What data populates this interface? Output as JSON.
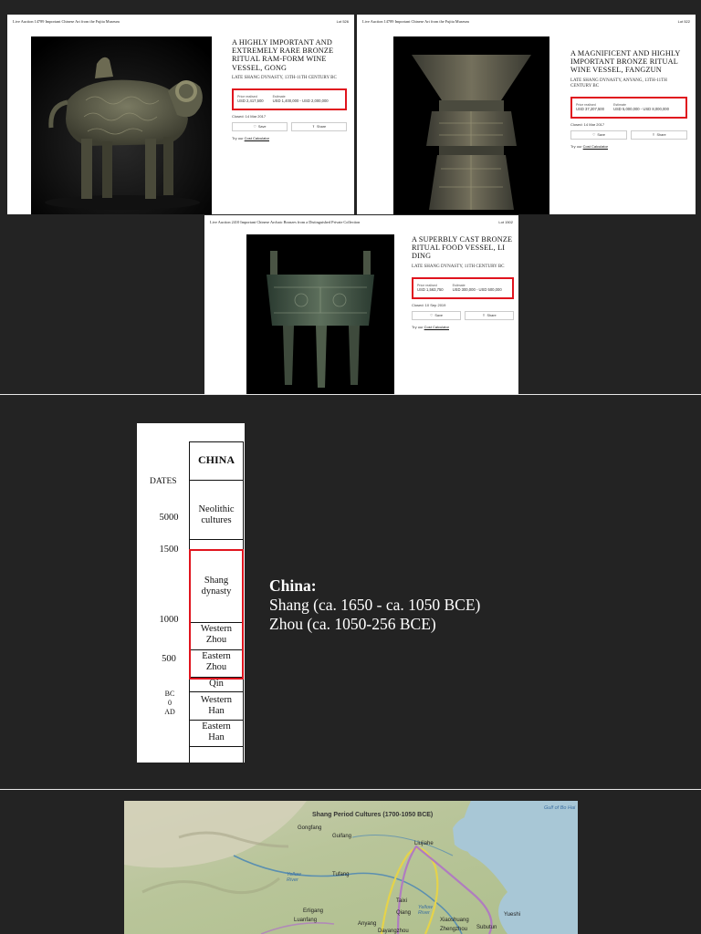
{
  "lots": [
    {
      "id": "lot-ram",
      "header_title": "Live Auction 14789 Important Chinese Art from the Fujita Museum",
      "lot_number": "Lot 526",
      "name": "A HIGHLY IMPORTANT AND EXTREMELY RARE BRONZE RITUAL RAM-FORM WINE VESSEL, GONG",
      "period": "LATE SHANG DYNASTY, 13TH-11TH CENTURY BC",
      "price_label": "Price realised",
      "price": "USD 2,417,500",
      "estimate_label": "Estimate",
      "estimate": "USD 1,400,000 - USD 2,000,000",
      "closed": "Closed: 14 Mar 2017",
      "save": "Save",
      "share": "Share",
      "cost_prefix": "Try our",
      "cost_link": "Cost Calculator"
    },
    {
      "id": "lot-fangzun",
      "header_title": "Live Auction 14789 Important Chinese Art from the Fujita Museum",
      "lot_number": "Lot 522",
      "name": "A MAGNIFICENT AND HIGHLY IMPORTANT BRONZE RITUAL WINE VESSEL, FANGZUN",
      "period": "LATE SHANG DYNASTY, ANYANG, 13TH-11TH CENTURY BC",
      "price_label": "Price realised",
      "price": "USD 37,207,500",
      "estimate_label": "Estimate",
      "estimate": "USD 5,000,000 - USD 8,000,000",
      "closed": "Closed: 14 Mar 2017",
      "save": "Save",
      "share": "Share",
      "cost_prefix": "Try our",
      "cost_link": "Cost Calculator"
    },
    {
      "id": "lot-liding",
      "header_title": "Live Auction 2410 Important Chinese Archaic Bronzes from a Distinguished Private Collection",
      "lot_number": "Lot 1502",
      "name": "A SUPERBLY CAST BRONZE RITUAL FOOD VESSEL, LI DING",
      "period": "LATE SHANG DYNASTY, 11TH CENTURY BC",
      "price_label": "Price realised",
      "price": "USD 1,563,750",
      "estimate_label": "Estimate",
      "estimate": "USD 300,000 - USD 500,000",
      "closed": "Closed: 10 Sep 2019",
      "save": "Save",
      "share": "Share",
      "cost_prefix": "Try our",
      "cost_link": "Cost Calculator"
    }
  ],
  "timeline": {
    "header": "CHINA",
    "dates_label": "DATES",
    "dates": [
      "5000",
      "1500",
      "1000",
      "500",
      "BC",
      "0",
      "AD"
    ],
    "periods": [
      "Neolithic cultures",
      "Shang dynasty",
      "Western Zhou",
      "Eastern Zhou",
      "Qin",
      "Western Han",
      "Eastern Han"
    ]
  },
  "china": {
    "heading": "China:",
    "line1": "Shang (ca. 1650 - ca. 1050 BCE)",
    "line2": "Zhou (ca. 1050-256 BCE)"
  },
  "map": {
    "title": "Shang Period Cultures (1700-1050 BCE)",
    "sea_label": "Gulf of Bo Hai",
    "places": [
      "Gongfang",
      "Guifang",
      "Liujiahe",
      "Tufang",
      "Yellow River",
      "Erligang",
      "Luanfang",
      "Taixi",
      "Yellow River",
      "Yueshi",
      "Qiang",
      "Anyang",
      "Xiaoshuang",
      "Zhengzhou",
      "Dayangzhou",
      "Subutun"
    ]
  },
  "colors": {
    "highlight": "#e0141e",
    "slide_bg": "#232323"
  }
}
